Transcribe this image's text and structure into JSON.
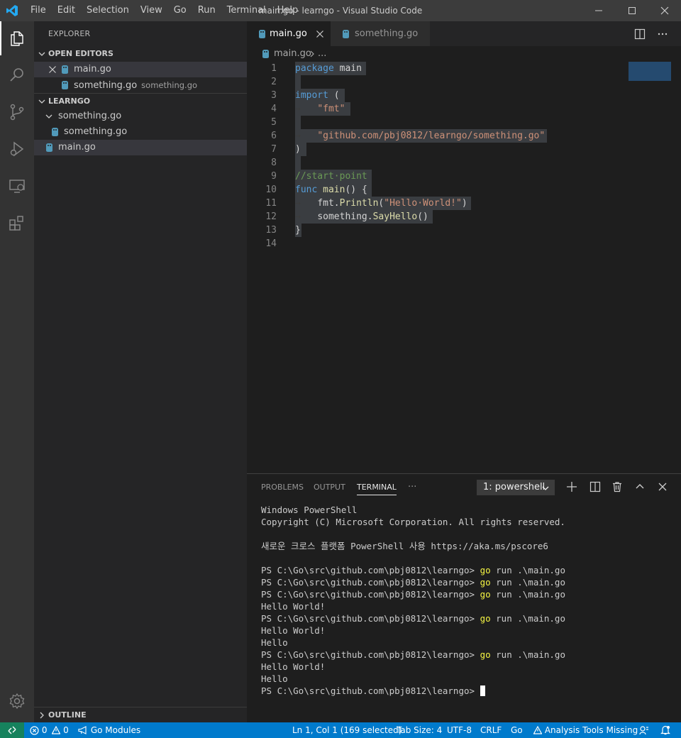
{
  "window": {
    "title": "main.go - learngo - Visual Studio Code",
    "menu": [
      "File",
      "Edit",
      "Selection",
      "View",
      "Go",
      "Run",
      "Terminal",
      "Help"
    ]
  },
  "activity_bar": {
    "items": [
      "explorer-icon",
      "search-icon",
      "source-control-icon",
      "run-debug-icon",
      "remote-explorer-icon",
      "extensions-icon"
    ],
    "bottom": [
      "settings-gear-icon"
    ]
  },
  "sidebar": {
    "title": "EXPLORER",
    "open_editors": {
      "header": "OPEN EDITORS",
      "items": [
        {
          "name": "main.go",
          "desc": ""
        },
        {
          "name": "something.go",
          "desc": "something.go"
        }
      ]
    },
    "workspace": {
      "header": "LEARNGO",
      "folder": "something.go",
      "folder_child": "something.go",
      "file": "main.go"
    },
    "outline": "OUTLINE"
  },
  "editor": {
    "tabs": [
      {
        "label": "main.go",
        "active": true
      },
      {
        "label": "something.go",
        "active": false
      }
    ],
    "breadcrumb": {
      "file": "main.go",
      "rest": "..."
    },
    "lines": [
      {
        "n": "1",
        "code": "package main"
      },
      {
        "n": "2",
        "code": ""
      },
      {
        "n": "3",
        "code": "import ("
      },
      {
        "n": "4",
        "code": "\t\"fmt\""
      },
      {
        "n": "5",
        "code": ""
      },
      {
        "n": "6",
        "code": "\t\"github.com/pbj0812/learngo/something.go\""
      },
      {
        "n": "7",
        "code": ")"
      },
      {
        "n": "8",
        "code": ""
      },
      {
        "n": "9",
        "code": "//start point"
      },
      {
        "n": "10",
        "code": "func main() {"
      },
      {
        "n": "11",
        "code": "\tfmt.Println(\"Hello World!\")"
      },
      {
        "n": "12",
        "code": "\tsomething.SayHello()"
      },
      {
        "n": "13",
        "code": "}"
      },
      {
        "n": "14",
        "code": ""
      }
    ]
  },
  "panel": {
    "tabs": [
      "PROBLEMS",
      "OUTPUT",
      "TERMINAL"
    ],
    "active_tab": "TERMINAL",
    "more": "···",
    "terminal_select": "1: powershell",
    "terminal_lines": [
      "Windows PowerShell",
      "Copyright (C) Microsoft Corporation. All rights reserved.",
      "",
      "새로운 크로스 플랫폼 PowerShell 사용 https://aka.ms/pscore6",
      "",
      "PS C:\\Go\\src\\github.com\\pbj0812\\learngo> go run .\\main.go",
      "PS C:\\Go\\src\\github.com\\pbj0812\\learngo> go run .\\main.go",
      "PS C:\\Go\\src\\github.com\\pbj0812\\learngo> go run .\\main.go",
      "Hello World!",
      "PS C:\\Go\\src\\github.com\\pbj0812\\learngo> go run .\\main.go",
      "Hello World!",
      "Hello",
      "PS C:\\Go\\src\\github.com\\pbj0812\\learngo> go run .\\main.go",
      "Hello World!",
      "Hello",
      "PS C:\\Go\\src\\github.com\\pbj0812\\learngo> "
    ]
  },
  "status_bar": {
    "errors": "0",
    "warnings": "0",
    "go_modules": "Go Modules",
    "position": "Ln 1, Col 1 (169 selected)",
    "tab_size": "Tab Size: 4",
    "encoding": "UTF-8",
    "eol": "CRLF",
    "language": "Go",
    "analysis": "Analysis Tools Missing"
  },
  "colors": {
    "accent": "#007acc",
    "remote": "#16825d",
    "go_icon": "#519aba",
    "keyword": "#569cd6",
    "string": "#ce9178",
    "comment": "#6a9955",
    "function": "#dcdcaa",
    "terminal_go": "#f5f543"
  }
}
